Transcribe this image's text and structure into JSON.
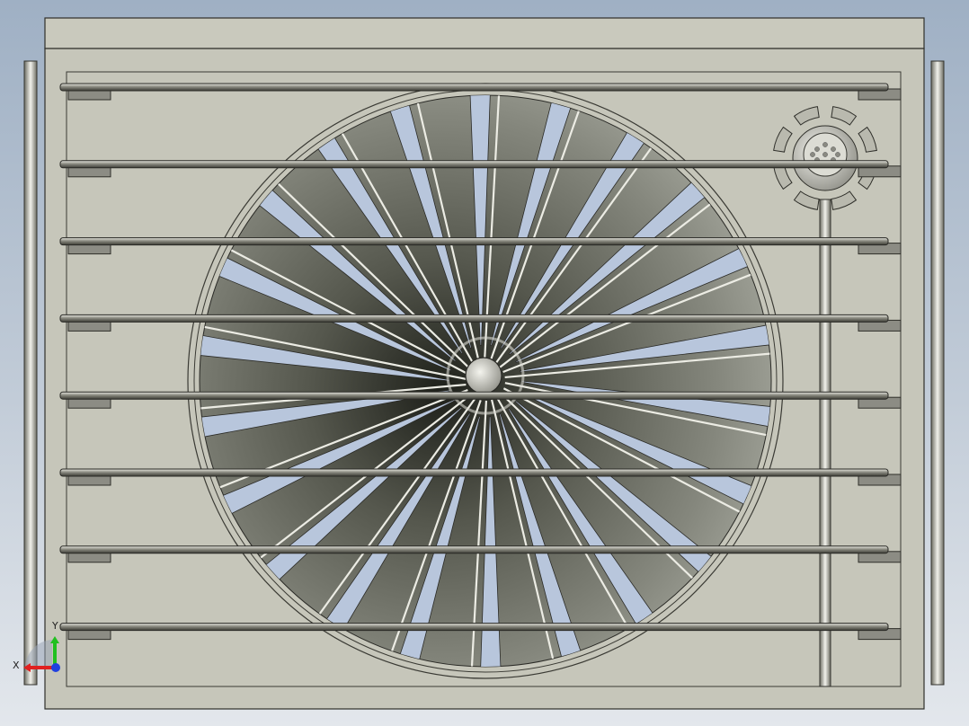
{
  "viewport": {
    "background_top": "#9fb0c4",
    "background_bottom": "#e3e7ec"
  },
  "model": {
    "housing_color": "#c6c6ba",
    "housing_edge": "#3a3a34",
    "grille_bar_count": 8,
    "fan_blade_count": 22,
    "fan_dark": "#2e3028",
    "fan_light": "#9a9c92",
    "blade_slot_color": "#b8c6dc",
    "bracket_teeth": 8
  },
  "triad": {
    "x_label": "X",
    "y_label": "Y",
    "x_color": "#e02020",
    "y_color": "#20c020",
    "z_color": "#2040e0"
  }
}
